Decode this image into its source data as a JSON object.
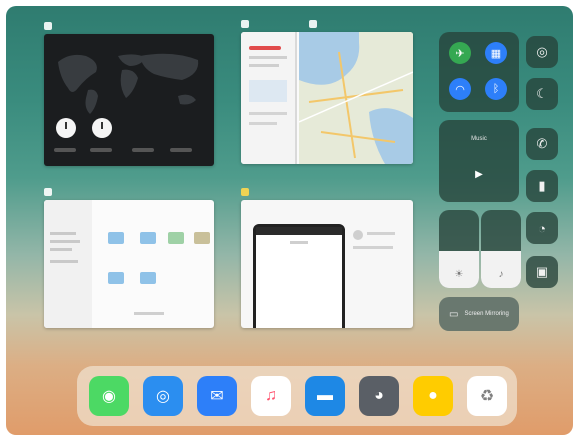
{
  "app_switcher": {
    "cards": [
      {
        "app": "Clock",
        "icon": "clock-icon"
      },
      {
        "apps": [
          "Safari",
          "Maps"
        ],
        "icons": [
          "safari-icon",
          "maps-icon"
        ]
      },
      {
        "app": "Files",
        "icon": "files-icon"
      },
      {
        "app": "Notes",
        "icon": "notes-icon"
      }
    ]
  },
  "control_center": {
    "music_label": "Music",
    "screen_mirroring_label": "Screen Mirroring",
    "icons": [
      "airplane-mode-icon",
      "cellular-data-icon",
      "wifi-icon",
      "bluetooth-icon",
      "rotation-lock-icon",
      "do-not-disturb-icon",
      "phone-icon",
      "flashlight-icon",
      "timer-icon",
      "camera-icon",
      "play-icon",
      "brightness-icon",
      "volume-icon",
      "screen-mirroring-icon"
    ],
    "levels": {
      "brightness": 0.48,
      "volume": 0.48
    }
  },
  "dock": {
    "apps": [
      {
        "name": "Messages",
        "icon": "messages-icon",
        "color": "#4cd964"
      },
      {
        "name": "Safari",
        "icon": "safari-icon",
        "color": "#2b8ef0"
      },
      {
        "name": "Mail",
        "icon": "mail-icon",
        "color": "#2d7ff9"
      },
      {
        "name": "Music",
        "icon": "music-icon",
        "color": "#ffffff"
      },
      {
        "name": "Files",
        "icon": "files-icon",
        "color": "#1e88e5"
      },
      {
        "name": "Camera",
        "icon": "camera-icon",
        "color": "#5a5f66"
      },
      {
        "name": "Tips",
        "icon": "tips-icon",
        "color": "#ffcc00"
      },
      {
        "name": "Recycle",
        "icon": "recycle-icon",
        "color": "#ffffff"
      }
    ]
  }
}
